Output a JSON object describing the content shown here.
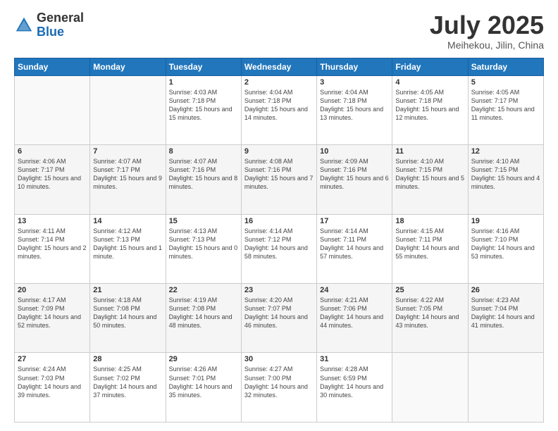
{
  "header": {
    "logo_general": "General",
    "logo_blue": "Blue",
    "month_title": "July 2025",
    "subtitle": "Meihekou, Jilin, China"
  },
  "days_of_week": [
    "Sunday",
    "Monday",
    "Tuesday",
    "Wednesday",
    "Thursday",
    "Friday",
    "Saturday"
  ],
  "weeks": [
    [
      {
        "day": "",
        "sunrise": "",
        "sunset": "",
        "daylight": ""
      },
      {
        "day": "",
        "sunrise": "",
        "sunset": "",
        "daylight": ""
      },
      {
        "day": "1",
        "sunrise": "Sunrise: 4:03 AM",
        "sunset": "Sunset: 7:18 PM",
        "daylight": "Daylight: 15 hours and 15 minutes."
      },
      {
        "day": "2",
        "sunrise": "Sunrise: 4:04 AM",
        "sunset": "Sunset: 7:18 PM",
        "daylight": "Daylight: 15 hours and 14 minutes."
      },
      {
        "day": "3",
        "sunrise": "Sunrise: 4:04 AM",
        "sunset": "Sunset: 7:18 PM",
        "daylight": "Daylight: 15 hours and 13 minutes."
      },
      {
        "day": "4",
        "sunrise": "Sunrise: 4:05 AM",
        "sunset": "Sunset: 7:18 PM",
        "daylight": "Daylight: 15 hours and 12 minutes."
      },
      {
        "day": "5",
        "sunrise": "Sunrise: 4:05 AM",
        "sunset": "Sunset: 7:17 PM",
        "daylight": "Daylight: 15 hours and 11 minutes."
      }
    ],
    [
      {
        "day": "6",
        "sunrise": "Sunrise: 4:06 AM",
        "sunset": "Sunset: 7:17 PM",
        "daylight": "Daylight: 15 hours and 10 minutes."
      },
      {
        "day": "7",
        "sunrise": "Sunrise: 4:07 AM",
        "sunset": "Sunset: 7:17 PM",
        "daylight": "Daylight: 15 hours and 9 minutes."
      },
      {
        "day": "8",
        "sunrise": "Sunrise: 4:07 AM",
        "sunset": "Sunset: 7:16 PM",
        "daylight": "Daylight: 15 hours and 8 minutes."
      },
      {
        "day": "9",
        "sunrise": "Sunrise: 4:08 AM",
        "sunset": "Sunset: 7:16 PM",
        "daylight": "Daylight: 15 hours and 7 minutes."
      },
      {
        "day": "10",
        "sunrise": "Sunrise: 4:09 AM",
        "sunset": "Sunset: 7:16 PM",
        "daylight": "Daylight: 15 hours and 6 minutes."
      },
      {
        "day": "11",
        "sunrise": "Sunrise: 4:10 AM",
        "sunset": "Sunset: 7:15 PM",
        "daylight": "Daylight: 15 hours and 5 minutes."
      },
      {
        "day": "12",
        "sunrise": "Sunrise: 4:10 AM",
        "sunset": "Sunset: 7:15 PM",
        "daylight": "Daylight: 15 hours and 4 minutes."
      }
    ],
    [
      {
        "day": "13",
        "sunrise": "Sunrise: 4:11 AM",
        "sunset": "Sunset: 7:14 PM",
        "daylight": "Daylight: 15 hours and 2 minutes."
      },
      {
        "day": "14",
        "sunrise": "Sunrise: 4:12 AM",
        "sunset": "Sunset: 7:13 PM",
        "daylight": "Daylight: 15 hours and 1 minute."
      },
      {
        "day": "15",
        "sunrise": "Sunrise: 4:13 AM",
        "sunset": "Sunset: 7:13 PM",
        "daylight": "Daylight: 15 hours and 0 minutes."
      },
      {
        "day": "16",
        "sunrise": "Sunrise: 4:14 AM",
        "sunset": "Sunset: 7:12 PM",
        "daylight": "Daylight: 14 hours and 58 minutes."
      },
      {
        "day": "17",
        "sunrise": "Sunrise: 4:14 AM",
        "sunset": "Sunset: 7:11 PM",
        "daylight": "Daylight: 14 hours and 57 minutes."
      },
      {
        "day": "18",
        "sunrise": "Sunrise: 4:15 AM",
        "sunset": "Sunset: 7:11 PM",
        "daylight": "Daylight: 14 hours and 55 minutes."
      },
      {
        "day": "19",
        "sunrise": "Sunrise: 4:16 AM",
        "sunset": "Sunset: 7:10 PM",
        "daylight": "Daylight: 14 hours and 53 minutes."
      }
    ],
    [
      {
        "day": "20",
        "sunrise": "Sunrise: 4:17 AM",
        "sunset": "Sunset: 7:09 PM",
        "daylight": "Daylight: 14 hours and 52 minutes."
      },
      {
        "day": "21",
        "sunrise": "Sunrise: 4:18 AM",
        "sunset": "Sunset: 7:08 PM",
        "daylight": "Daylight: 14 hours and 50 minutes."
      },
      {
        "day": "22",
        "sunrise": "Sunrise: 4:19 AM",
        "sunset": "Sunset: 7:08 PM",
        "daylight": "Daylight: 14 hours and 48 minutes."
      },
      {
        "day": "23",
        "sunrise": "Sunrise: 4:20 AM",
        "sunset": "Sunset: 7:07 PM",
        "daylight": "Daylight: 14 hours and 46 minutes."
      },
      {
        "day": "24",
        "sunrise": "Sunrise: 4:21 AM",
        "sunset": "Sunset: 7:06 PM",
        "daylight": "Daylight: 14 hours and 44 minutes."
      },
      {
        "day": "25",
        "sunrise": "Sunrise: 4:22 AM",
        "sunset": "Sunset: 7:05 PM",
        "daylight": "Daylight: 14 hours and 43 minutes."
      },
      {
        "day": "26",
        "sunrise": "Sunrise: 4:23 AM",
        "sunset": "Sunset: 7:04 PM",
        "daylight": "Daylight: 14 hours and 41 minutes."
      }
    ],
    [
      {
        "day": "27",
        "sunrise": "Sunrise: 4:24 AM",
        "sunset": "Sunset: 7:03 PM",
        "daylight": "Daylight: 14 hours and 39 minutes."
      },
      {
        "day": "28",
        "sunrise": "Sunrise: 4:25 AM",
        "sunset": "Sunset: 7:02 PM",
        "daylight": "Daylight: 14 hours and 37 minutes."
      },
      {
        "day": "29",
        "sunrise": "Sunrise: 4:26 AM",
        "sunset": "Sunset: 7:01 PM",
        "daylight": "Daylight: 14 hours and 35 minutes."
      },
      {
        "day": "30",
        "sunrise": "Sunrise: 4:27 AM",
        "sunset": "Sunset: 7:00 PM",
        "daylight": "Daylight: 14 hours and 32 minutes."
      },
      {
        "day": "31",
        "sunrise": "Sunrise: 4:28 AM",
        "sunset": "Sunset: 6:59 PM",
        "daylight": "Daylight: 14 hours and 30 minutes."
      },
      {
        "day": "",
        "sunrise": "",
        "sunset": "",
        "daylight": ""
      },
      {
        "day": "",
        "sunrise": "",
        "sunset": "",
        "daylight": ""
      }
    ]
  ]
}
